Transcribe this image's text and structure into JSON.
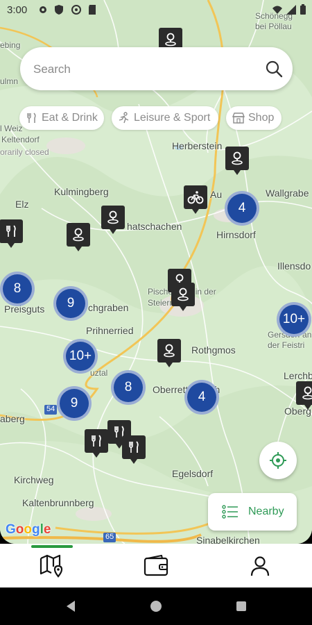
{
  "status_bar": {
    "time": "3:00"
  },
  "search": {
    "placeholder": "Search"
  },
  "filters": [
    {
      "label": "Eat & Drink",
      "icon": "fork-knife-icon"
    },
    {
      "label": "Leisure & Sport",
      "icon": "running-icon"
    },
    {
      "label": "Shop",
      "icon": "shop-icon"
    }
  ],
  "map_labels": {
    "schoenegg": "Schönegg",
    "bei_poellau": "bei Pöllau",
    "ebing": "ebing",
    "ulmn": "ulmn",
    "weiz": "l Weiz",
    "keltendorf": "Keltendorf",
    "keltendorf_status": "orarily closed",
    "herberstein": "Herberstein",
    "wallgraben": "Wallgrabe",
    "kulmingberg": "Kulmingberg",
    "au": "Au",
    "elz": "Elz",
    "hatschachen": "hatschachen",
    "hirnsdorf": "Hirnsdorf",
    "illensdorf": "Illensdo",
    "pischelsdorf": "Pischelsdorf in der Steiermark",
    "preisguts": "Preisguts",
    "chgraben": "chgraben",
    "prihnerried": "Prihnerried",
    "gersdorf": "Gersdorf an der Feistri",
    "rothgmos": "Rothgmos",
    "lerchb": "Lerchb",
    "uztal": "uztal",
    "oberrettenbach": "Oberrettenbach",
    "oberg": "Oberg",
    "berg": "aberg",
    "kirchweg": "Kirchweg",
    "egelsdorf": "Egelsdorf",
    "kaltenbrunnberg": "Kaltenbrunnberg",
    "sinabelkirchen": "Sinabelkirchen",
    "route_54": "54",
    "route_65": "65"
  },
  "clusters": [
    "4",
    "8",
    "9",
    "10+",
    "10+",
    "8",
    "9",
    "4"
  ],
  "nearby_button": {
    "label": "Nearby"
  },
  "google_logo": "Google",
  "bottom_nav": [
    "map-pin-icon",
    "wallet-icon",
    "profile-icon"
  ],
  "colors": {
    "cluster": "#1f4aa0",
    "accent_green": "#2e9a56",
    "map_bg": "#cfe5c4"
  }
}
